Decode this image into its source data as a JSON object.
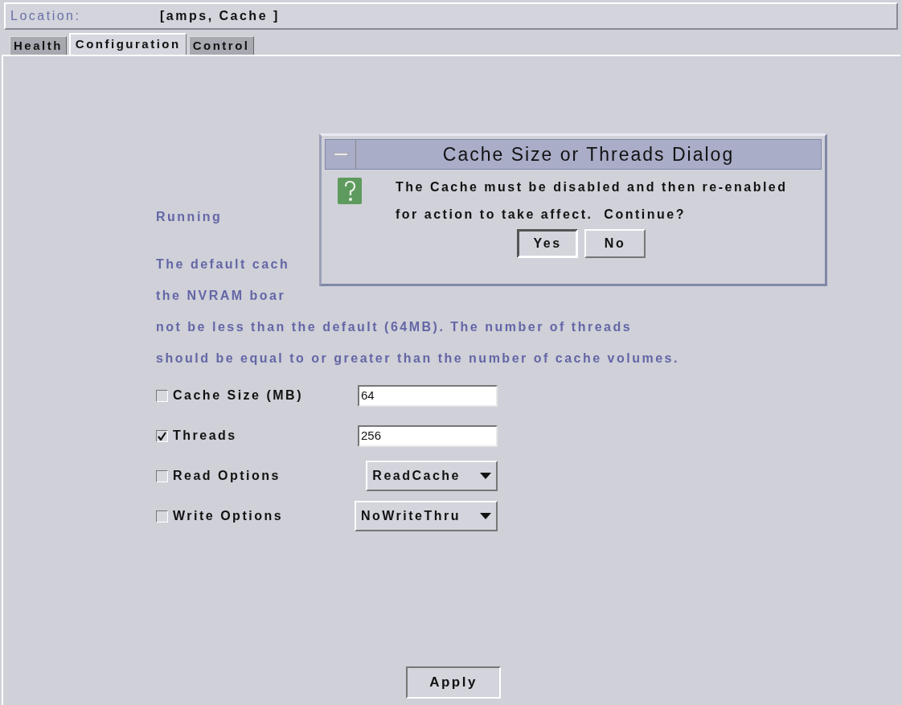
{
  "location": {
    "label": "Location:",
    "value": "[amps, Cache ]"
  },
  "tabs": [
    {
      "label": "Health",
      "selected": false
    },
    {
      "label": "Configuration",
      "selected": true
    },
    {
      "label": "Control",
      "selected": false
    }
  ],
  "status": "Running",
  "description_lines": [
    "The default cach",
    "the NVRAM boar",
    "not be less than the default (64MB). The number of threads",
    "should be equal to or greater than the number of cache volumes."
  ],
  "options": [
    {
      "kind": "text",
      "label": "Cache Size (MB)",
      "checked": false,
      "value": "64"
    },
    {
      "kind": "text",
      "label": "Threads",
      "checked": true,
      "value": "256"
    },
    {
      "kind": "select",
      "label": "Read Options",
      "checked": false,
      "value": "ReadCache"
    },
    {
      "kind": "select",
      "label": "Write Options",
      "checked": false,
      "value": "NoWriteThru"
    }
  ],
  "apply_button": "Apply",
  "dialog": {
    "title": "Cache Size or Threads Dialog",
    "message_lines": [
      "The Cache must be disabled and then re-enabled",
      "for action to take affect.  Continue?"
    ],
    "buttons": [
      {
        "label": "Yes",
        "selected": true
      },
      {
        "label": "No",
        "selected": false
      }
    ]
  }
}
